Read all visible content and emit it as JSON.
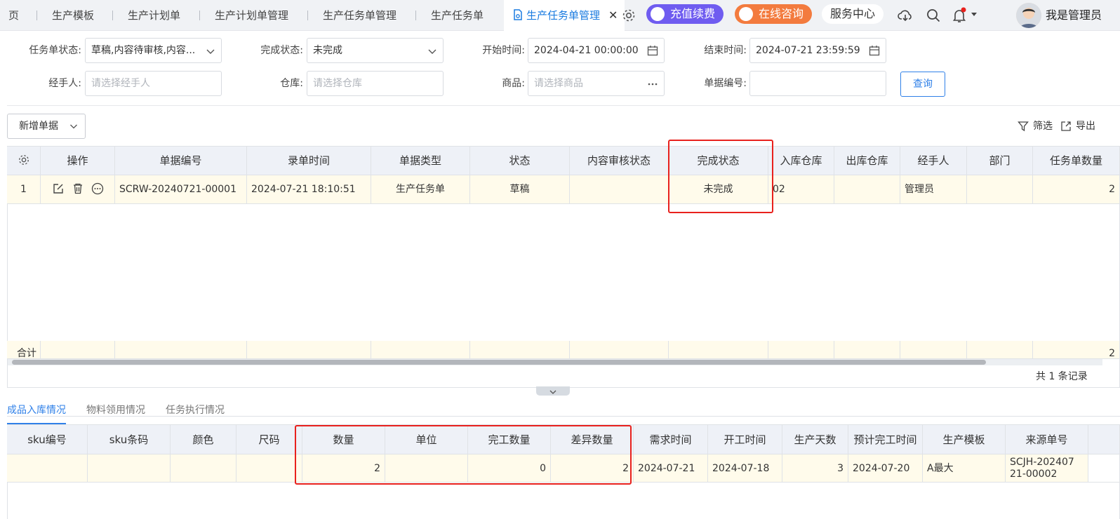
{
  "tabs": [
    {
      "label": "页"
    },
    {
      "label": "生产模板"
    },
    {
      "label": "生产计划单"
    },
    {
      "label": "生产计划单管理"
    },
    {
      "label": "生产任务单管理"
    },
    {
      "label": "生产任务单"
    },
    {
      "label": "生产任务单管理",
      "active": true
    }
  ],
  "tab_close": "✕",
  "header": {
    "recharge": "充值续费",
    "consult": "在线咨询",
    "service": "服务中心",
    "user": "我是管理员"
  },
  "colors": {
    "accent": "#2f80e8",
    "recharge": "#6f5cf0",
    "consult": "#f37b3e",
    "highlight": "#e8211d",
    "row": "#fffbeb"
  },
  "filters": {
    "task_status": {
      "label": "任务单状态:",
      "value": "草稿,内容待审核,内容..."
    },
    "done_status": {
      "label": "完成状态:",
      "value": "未完成"
    },
    "start_time": {
      "label": "开始时间:",
      "value": "2024-04-21 00:00:00"
    },
    "end_time": {
      "label": "结束时间:",
      "value": "2024-07-21 23:59:59"
    },
    "handler": {
      "label": "经手人:",
      "placeholder": "请选择经手人"
    },
    "warehouse": {
      "label": "仓库:",
      "placeholder": "请选择仓库"
    },
    "product": {
      "label": "商品:",
      "placeholder": "请选择商品"
    },
    "doc_no": {
      "label": "单据编号:",
      "value": ""
    },
    "query": "查询"
  },
  "toolbar": {
    "new": "新增单据",
    "filter": "筛选",
    "export": "导出"
  },
  "main_table": {
    "headers": [
      "",
      "操作",
      "单据编号",
      "录单时间",
      "单据类型",
      "状态",
      "内容审核状态",
      "完成状态",
      "入库仓库",
      "出库仓库",
      "经手人",
      "部门",
      "任务单数量"
    ],
    "row": [
      "1",
      "",
      "SCRW-20240721-00001",
      "2024-07-21 18:10:51",
      "生产任务单",
      "草稿",
      "",
      "未完成",
      "02",
      "",
      "管理员",
      "",
      "2"
    ],
    "footer_label": "合计",
    "footer_total": "2",
    "record_count": "共 1 条记录"
  },
  "bottom_tabs": [
    "成品入库情况",
    "物料领用情况",
    "任务执行情况"
  ],
  "detail_table": {
    "headers": [
      "sku编号",
      "sku条码",
      "颜色",
      "尺码",
      "数量",
      "单位",
      "完工数量",
      "差异数量",
      "需求时间",
      "开工时间",
      "生产天数",
      "预计完工时间",
      "生产模板",
      "来源单号"
    ],
    "row": [
      "",
      "",
      "",
      "",
      "2",
      "",
      "0",
      "2",
      "2024-07-21",
      "2024-07-18",
      "3",
      "2024-07-20",
      "A最大",
      "SCJH-202407\n21-00002"
    ]
  }
}
